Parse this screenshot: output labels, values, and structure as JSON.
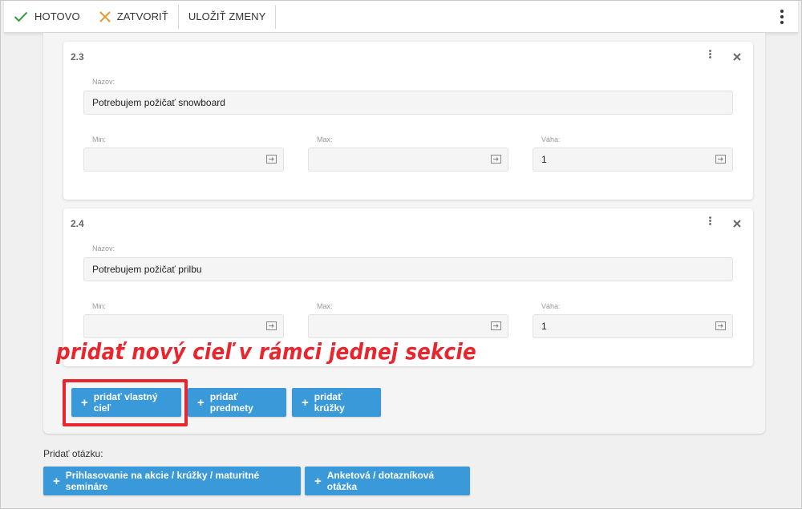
{
  "toolbar": {
    "done_label": "HOTOVO",
    "close_label": "ZATVORIŤ",
    "save_label": "ULOŽIŤ ZMENY",
    "done_icon": "checkmark-icon",
    "close_icon": "x-icon",
    "more_icon": "kebab-menu-icon",
    "colors": {
      "done": "#2e9e44",
      "close": "#e8962e"
    }
  },
  "goals": [
    {
      "number": "2.3",
      "name_label": "Názov:",
      "name_value": "Potrebujem požičať snowboard",
      "min_label": "Min:",
      "min_value": "",
      "max_label": "Max:",
      "max_value": "",
      "weight_label": "Váha:",
      "weight_value": "1"
    },
    {
      "number": "2.4",
      "name_label": "Názov:",
      "name_value": "Potrebujem požičať prilbu",
      "min_label": "Min:",
      "min_value": "",
      "max_label": "Max:",
      "max_value": "",
      "weight_label": "Váha:",
      "weight_value": "1"
    }
  ],
  "annotation": {
    "text": "pridať nový cieľ v rámci jednej sekcie",
    "color": "#e8262e"
  },
  "section_buttons": {
    "add_custom_goal": "pridať vlastný cieľ",
    "add_subjects": "pridať predmety",
    "add_clubs": "pridať krúžky"
  },
  "add_question": {
    "label": "Pridať otázku:",
    "registration_button": "Prihlasovanie na akcie / krúžky / maturitné semináre",
    "survey_button": "Anketová / dotazníková otázka"
  },
  "accent_color": "#3a9ad9"
}
